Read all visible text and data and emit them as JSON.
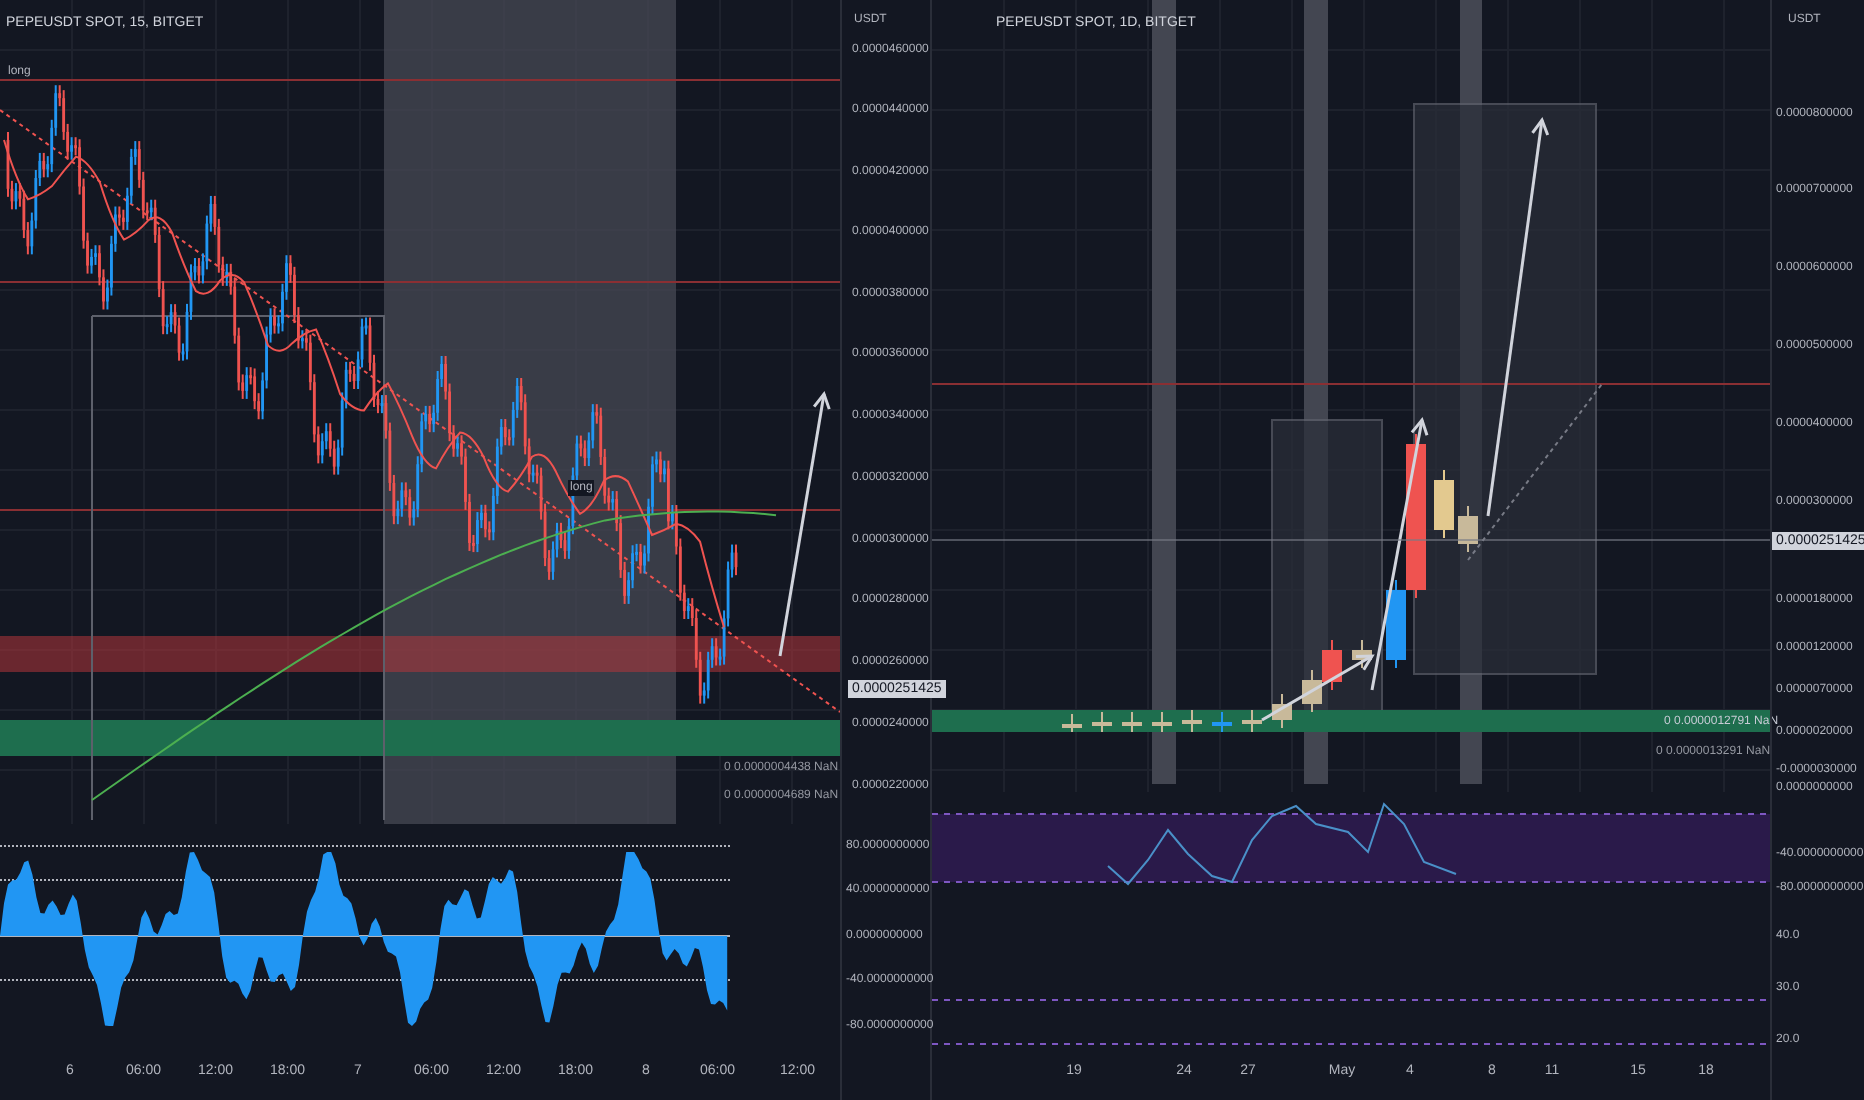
{
  "left_panel": {
    "title": "PEPEUSDT SPOT, 15, BITGET",
    "currency": "USDT",
    "price_axis": [
      "0.0000460000",
      "0.0000440000",
      "0.0000420000",
      "0.0000400000",
      "0.0000380000",
      "0.0000360000",
      "0.0000340000",
      "0.0000320000",
      "0.0000300000",
      "0.0000280000",
      "0.0000260000",
      "0.0000240000",
      "0.0000220000"
    ],
    "price_tag": "0.0000251425",
    "chart_labels": [
      "long",
      "long"
    ],
    "overlay_labels": [
      "0  0.0000004438  NaN",
      "0  0.0000004689  NaN"
    ],
    "indicator_axis": [
      "80.0000000000",
      "40.0000000000",
      "0.0000000000",
      "-40.0000000000",
      "-80.0000000000"
    ],
    "time_axis": [
      "6",
      "06:00",
      "12:00",
      "18:00",
      "7",
      "06:00",
      "12:00",
      "18:00",
      "8",
      "06:00",
      "12:00"
    ]
  },
  "right_panel": {
    "title": "PEPEUSDT SPOT, 1D, BITGET",
    "currency": "USDT",
    "price_axis": [
      "0.0000800000",
      "0.0000700000",
      "0.0000600000",
      "0.0000500000",
      "0.0000400000",
      "0.0000300000",
      "0.0000180000",
      "0.0000120000",
      "0.0000070000",
      "0.0000020000",
      "-0.0000030000",
      "0.0000000000"
    ],
    "price_tag": "0.0000251425",
    "overlay_labels": [
      "0  0.0000012791  NaN",
      "0  0.0000013291  NaN"
    ],
    "indicator_axis": [
      "-40.0000000000",
      "-80.0000000000",
      "40.0",
      "30.0",
      "20.0"
    ],
    "time_axis": [
      "19",
      "24",
      "27",
      "May",
      "4",
      "8",
      "11",
      "15",
      "18"
    ]
  }
}
